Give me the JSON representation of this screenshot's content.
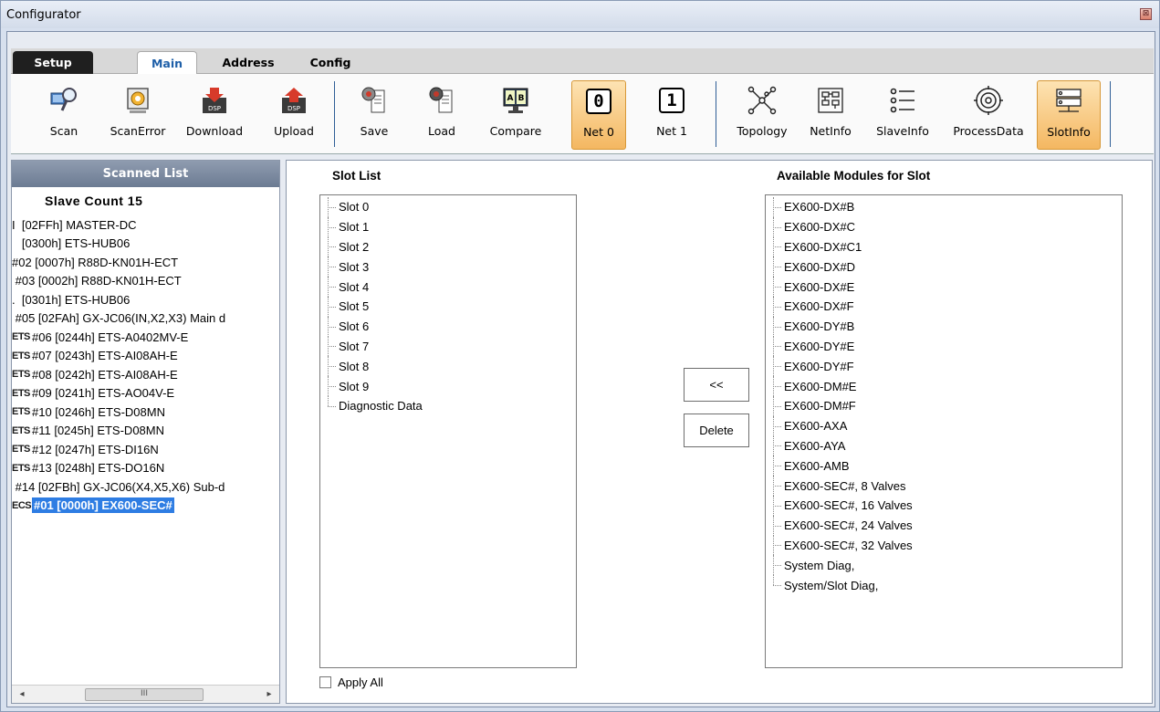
{
  "window": {
    "title": "Configurator",
    "close_glyph": "⊠"
  },
  "tabs": [
    {
      "label": "Setup"
    },
    {
      "label": "Main"
    },
    {
      "label": "Address"
    },
    {
      "label": "Config"
    }
  ],
  "toolbar": {
    "scan": "Scan",
    "scan_error": "ScanError",
    "download": "Download",
    "upload": "Upload",
    "save": "Save",
    "load": "Load",
    "compare": "Compare",
    "net0": "Net 0",
    "net0_digit": "0",
    "net1": "Net 1",
    "net1_digit": "1",
    "topology": "Topology",
    "netinfo": "NetInfo",
    "slaveinfo": "SlaveInfo",
    "processdata": "ProcessData",
    "slotinfo": "SlotInfo",
    "dsp_label": "DSP",
    "compare_a": "A",
    "compare_b": "B"
  },
  "scanned_list": {
    "header": "Scanned List",
    "slave_count": "Slave Count  15",
    "items": [
      {
        "badge": "",
        "text": "[02FFh] MASTER-DC",
        "pre": "I  "
      },
      {
        "badge": "",
        "text": "[0300h] ETS-HUB06",
        "pre": "   "
      },
      {
        "badge": "",
        "text": "#02  [0007h] R88D-KN01H-ECT",
        "pre": ""
      },
      {
        "badge": "",
        "text": "#03  [0002h] R88D-KN01H-ECT",
        "pre": " "
      },
      {
        "badge": "",
        "text": "[0301h] ETS-HUB06",
        "pre": ".  "
      },
      {
        "badge": "",
        "text": "#05  [02FAh] GX-JC06(IN,X2,X3) Main d",
        "pre": " "
      },
      {
        "badge": "ETS",
        "text": "#06  [0244h] ETS-A0402MV-E",
        "pre": ""
      },
      {
        "badge": "ETS",
        "text": "#07  [0243h] ETS-AI08AH-E",
        "pre": ""
      },
      {
        "badge": "ETS",
        "text": "#08  [0242h] ETS-AI08AH-E",
        "pre": ""
      },
      {
        "badge": "ETS",
        "text": "#09  [0241h] ETS-AO04V-E",
        "pre": ""
      },
      {
        "badge": "ETS",
        "text": "#10  [0246h] ETS-D08MN",
        "pre": ""
      },
      {
        "badge": "ETS",
        "text": "#11  [0245h] ETS-D08MN",
        "pre": ""
      },
      {
        "badge": "ETS",
        "text": "#12  [0247h] ETS-DI16N",
        "pre": ""
      },
      {
        "badge": "ETS",
        "text": "#13  [0248h] ETS-DO16N",
        "pre": ""
      },
      {
        "badge": "",
        "text": "#14  [02FBh] GX-JC06(X4,X5,X6) Sub-d",
        "pre": " "
      },
      {
        "badge": "ECS",
        "text": "#01  [0000h] EX600-SEC#",
        "pre": "",
        "selected": true
      }
    ],
    "scroll_left": "◂",
    "scroll_right": "▸",
    "scroll_grip": "III"
  },
  "slot_list": {
    "title": "Slot List",
    "items": [
      "Slot 0",
      "Slot 1",
      "Slot 2",
      "Slot 3",
      "Slot 4",
      "Slot 5",
      "Slot 6",
      "Slot 7",
      "Slot 8",
      "Slot 9",
      "Diagnostic Data"
    ]
  },
  "modules": {
    "title": "Available Modules for Slot",
    "items": [
      "EX600-DX#B",
      "EX600-DX#C",
      "EX600-DX#C1",
      "EX600-DX#D",
      "EX600-DX#E",
      "EX600-DX#F",
      "EX600-DY#B",
      "EX600-DY#E",
      "EX600-DY#F",
      "EX600-DM#E",
      "EX600-DM#F",
      "EX600-AXA",
      "EX600-AYA",
      "EX600-AMB",
      "EX600-SEC#, 8 Valves",
      "EX600-SEC#, 16 Valves",
      "EX600-SEC#, 24 Valves",
      "EX600-SEC#, 32 Valves",
      "System Diag,",
      "System/Slot Diag,"
    ]
  },
  "buttons": {
    "move": "<<",
    "delete": "Delete"
  },
  "apply_all": "Apply All",
  "colors": {
    "active_orange": "#f4b761",
    "selection_blue": "#2e7de3",
    "header_gray": "#7d8aa0"
  }
}
